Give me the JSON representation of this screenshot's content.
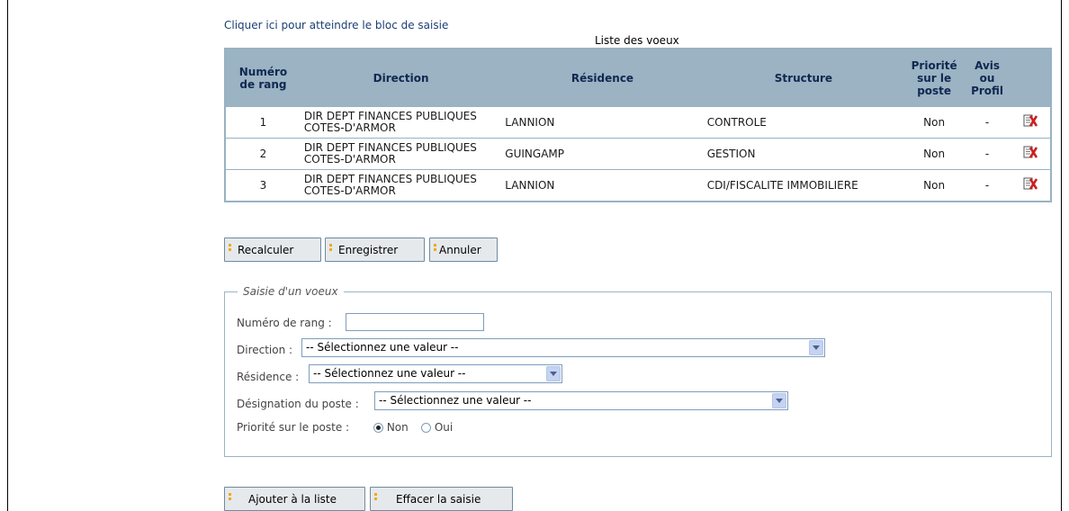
{
  "skip_link": "Cliquer ici pour atteindre le bloc de saisie",
  "table": {
    "caption": "Liste des voeux",
    "headers": {
      "rang": [
        "Numéro",
        "de rang"
      ],
      "direction": "Direction",
      "residence": "Résidence",
      "structure": "Structure",
      "priorite": [
        "Priorité",
        "sur le",
        "poste"
      ],
      "avis": [
        "Avis",
        "ou",
        "Profil"
      ]
    },
    "rows": [
      {
        "rang": "1",
        "direction": [
          "DIR DEPT FINANCES PUBLIQUES",
          "COTES-D'ARMOR"
        ],
        "residence": "LANNION",
        "structure": "CONTROLE",
        "priorite": "Non",
        "avis": "-"
      },
      {
        "rang": "2",
        "direction": [
          "DIR DEPT FINANCES PUBLIQUES",
          "COTES-D'ARMOR"
        ],
        "residence": "GUINGAMP",
        "structure": "GESTION",
        "priorite": "Non",
        "avis": "-"
      },
      {
        "rang": "3",
        "direction": [
          "DIR DEPT FINANCES PUBLIQUES",
          "COTES-D'ARMOR"
        ],
        "residence": "LANNION",
        "structure": "CDI/FISCALITE IMMOBILIERE",
        "priorite": "Non",
        "avis": "-"
      }
    ],
    "delete_icon": "delete-row-icon"
  },
  "actions": {
    "recalculer": "Recalculer",
    "enregistrer": "Enregistrer",
    "annuler": "Annuler"
  },
  "form": {
    "legend": "Saisie d'un voeux",
    "rang_label": "Numéro de rang :",
    "rang_value": "",
    "direction_label": "Direction :",
    "direction_value": "-- Sélectionnez une valeur --",
    "residence_label": "Résidence :",
    "residence_value": "-- Sélectionnez une valeur --",
    "designation_label": "Désignation du poste :",
    "designation_value": "-- Sélectionnez une valeur --",
    "priorite_label": "Priorité sur le poste :",
    "priorite_options": [
      "Non",
      "Oui"
    ],
    "priorite_selected": "Non"
  },
  "bottom_actions": {
    "ajouter": "Ajouter à la liste",
    "effacer": "Effacer la saisie"
  },
  "colors": {
    "header_bg": "#9bb3c3",
    "button_bullet": "#f2a81d",
    "link": "#1b3e74",
    "delete_icon": "#cc1f1f"
  }
}
